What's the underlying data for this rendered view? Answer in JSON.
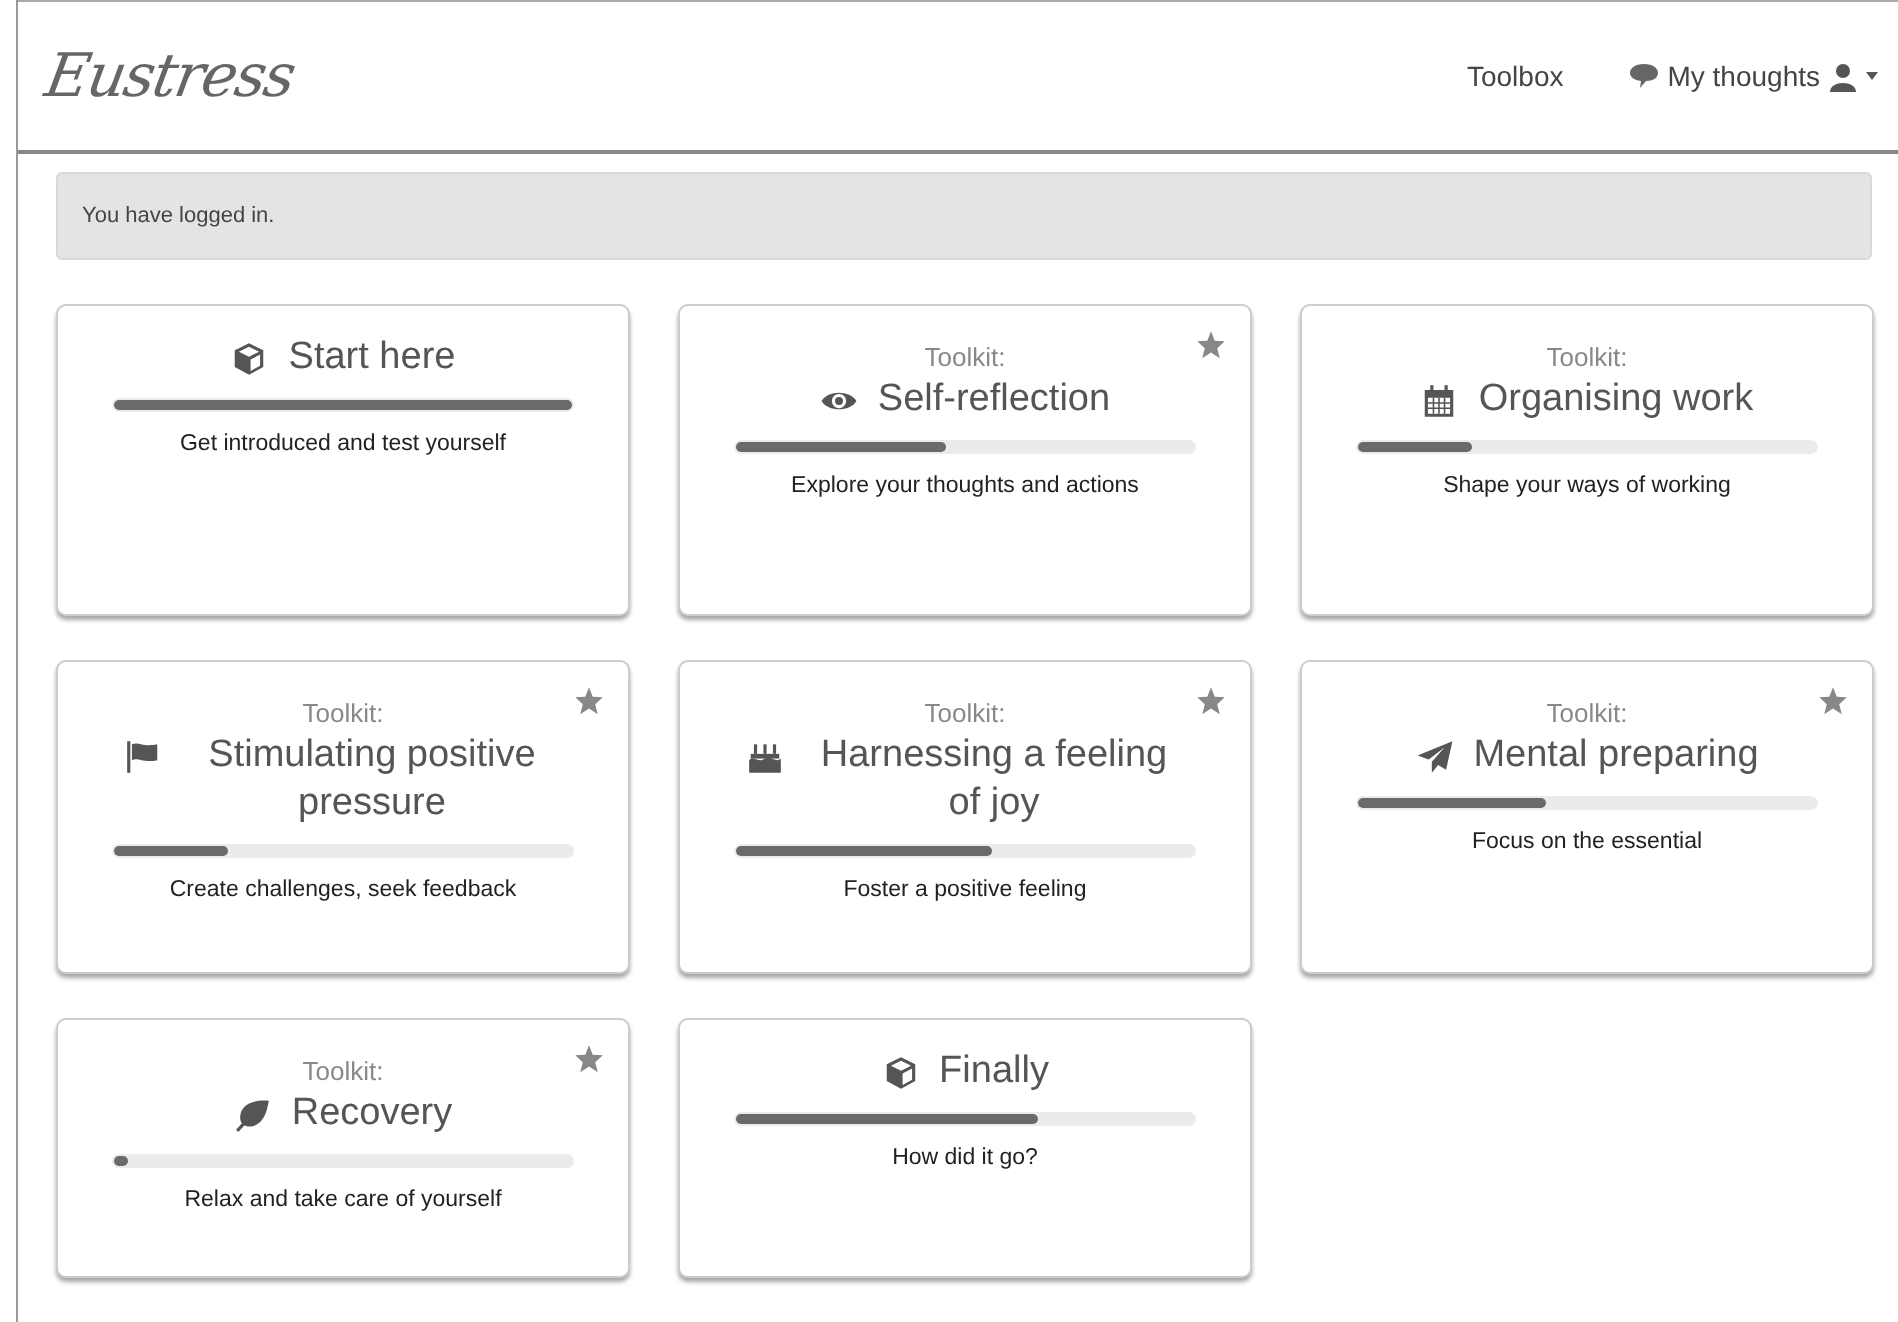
{
  "header": {
    "logo": "Eustress",
    "nav": [
      {
        "kind": "link",
        "label": "Toolbox"
      },
      {
        "kind": "menu",
        "label": "My thoughts"
      }
    ]
  },
  "alert": {
    "text": "You have logged in."
  },
  "cards": [
    {
      "title": "Start here",
      "description": "Get introduced and test yourself",
      "level": 1.0,
      "starred": false
    },
    {
      "label": "Toolkit:",
      "title": "Self-reflection",
      "description": "Explore your thoughts and actions",
      "level": 0.46,
      "starred": true
    },
    {
      "label": "Toolkit:",
      "title": "Organising work",
      "description": "Shape your ways of working",
      "level": 0.25,
      "starred": false
    },
    {
      "label": "Toolkit:",
      "title": "Stimulating positive pressure",
      "description": "Create challenges, seek feedback",
      "level": 0.25,
      "starred": true
    },
    {
      "label": "Toolkit:",
      "title": "Harnessing a feeling of joy",
      "description": "Foster a positive feeling",
      "level": 0.56,
      "starred": true
    },
    {
      "label": "Toolkit:",
      "title": "Mental preparing",
      "description": "Focus on the essential",
      "level": 0.41,
      "starred": true
    },
    {
      "label": "Toolkit:",
      "title": "Recovery",
      "description": "Relax and take care of yourself",
      "level": 0.03,
      "starred": true
    },
    {
      "title": "Finally",
      "description": "How did it go?",
      "level": 0.66,
      "starred": false
    }
  ]
}
